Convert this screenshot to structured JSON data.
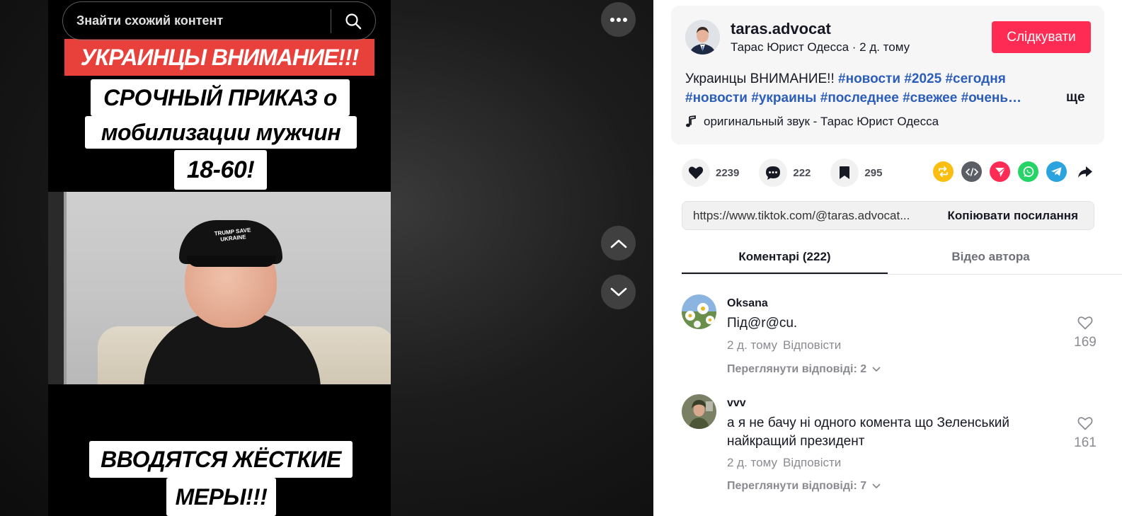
{
  "search": {
    "placeholder": "Знайти схожий контент"
  },
  "video": {
    "headline": "УКРАИНЦЫ ВНИМАНИЕ!!!",
    "line1": "СРОЧНЫЙ ПРИКАЗ о",
    "line2": "мобилизации мужчин",
    "line3": "18-60!",
    "line4": "ВВОДЯТСЯ ЖЁСТКИЕ",
    "line5": "МЕРЫ!!!",
    "cap_text": "TRUMP SAVE UKRAINE"
  },
  "author": {
    "username": "taras.advocat",
    "display_name": "Тарас Юрист Одесса",
    "separator": " · ",
    "posted": "2 д. тому",
    "follow_label": "Слідкувати"
  },
  "description": {
    "text": "Украинцы ВНИМАНИЕ!! ",
    "tags_line1": [
      "#новости",
      "#2025",
      "#сегодня"
    ],
    "tags_line2": [
      "#новости",
      "#украины",
      "#последнее",
      "#свежее",
      "#очень…"
    ],
    "more_label": "ще"
  },
  "sound": {
    "label": "оригинальный звук - Тарас Юрист Одесса"
  },
  "stats": {
    "likes": "2239",
    "comments": "222",
    "saves": "295"
  },
  "share_colors": {
    "repost": "#fbbd10",
    "embed": "#5c5e66",
    "send": "#fe2c55",
    "whatsapp": "#25d366",
    "telegram": "#2aa3df"
  },
  "link": {
    "url": "https://www.tiktok.com/@taras.advocat...",
    "copy_label": "Копіювати посилання"
  },
  "tabs": [
    {
      "label": "Коментарі (222)",
      "active": true
    },
    {
      "label": "Відео автора",
      "active": false
    }
  ],
  "comments": [
    {
      "user": "Oksana",
      "text": "Під@r@cu.",
      "time": "2 д. тому",
      "reply_label": "Відповісти",
      "view_replies": "Переглянути відповіді: 2",
      "likes": "169"
    },
    {
      "user": "vvv",
      "text": "а я не бачу ні одного комента що Зеленський найкращий президент",
      "time": "2 д. тому",
      "reply_label": "Відповісти",
      "view_replies": "Переглянути відповіді: 7",
      "likes": "161"
    }
  ]
}
